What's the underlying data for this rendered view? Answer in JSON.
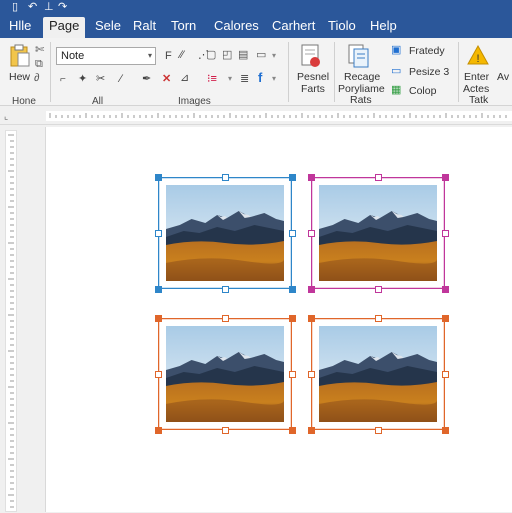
{
  "tabs": [
    {
      "label": "Hlle",
      "active": false
    },
    {
      "label": "Page",
      "active": true
    },
    {
      "label": "Sele",
      "active": false
    },
    {
      "label": "Ralt",
      "active": false
    },
    {
      "label": "Torn",
      "active": false
    },
    {
      "label": "Calores",
      "active": false
    },
    {
      "label": "Carhert",
      "active": false
    },
    {
      "label": "Tiolo",
      "active": false
    },
    {
      "label": "Help",
      "active": false
    }
  ],
  "ribbon": {
    "new_label": "Hew",
    "font_name": "Note",
    "group_home": "Hone",
    "group_all": "All",
    "group_images": "Images",
    "resize_label_1": "Pesnel",
    "resize_label_2": "Farts",
    "recage_label_1": "Recage",
    "recage_label_2": "Poryliame",
    "recage_label_3": "Rats",
    "fratedy_label": "Fratedy",
    "pesize_label": "Pesize 3",
    "colop_label": "Colop",
    "enter_label_1": "Enter",
    "enter_label_2": "Actes",
    "enter_label_3": "Tatk",
    "av_label": "Av"
  },
  "colors": {
    "title_bar": "#2b579a",
    "frame_blue": "#2e86c9",
    "frame_magenta": "#c0369b",
    "frame_orange": "#e0662a"
  },
  "icons": [
    "document-icon",
    "undo-icon",
    "redo-icon",
    "paste-icon",
    "cut-icon",
    "copy-icon",
    "format-icon",
    "bold-icon",
    "strikethrough-icon",
    "bullets-icon",
    "align-icon",
    "shapes-icon",
    "style-icon",
    "picture-icon",
    "warning-icon"
  ],
  "images": [
    {
      "name": "mountain-image-1",
      "frame": "frame_blue"
    },
    {
      "name": "mountain-image-2",
      "frame": "frame_magenta"
    },
    {
      "name": "mountain-image-3",
      "frame": "frame_orange"
    },
    {
      "name": "mountain-image-4",
      "frame": "frame_orange"
    }
  ]
}
